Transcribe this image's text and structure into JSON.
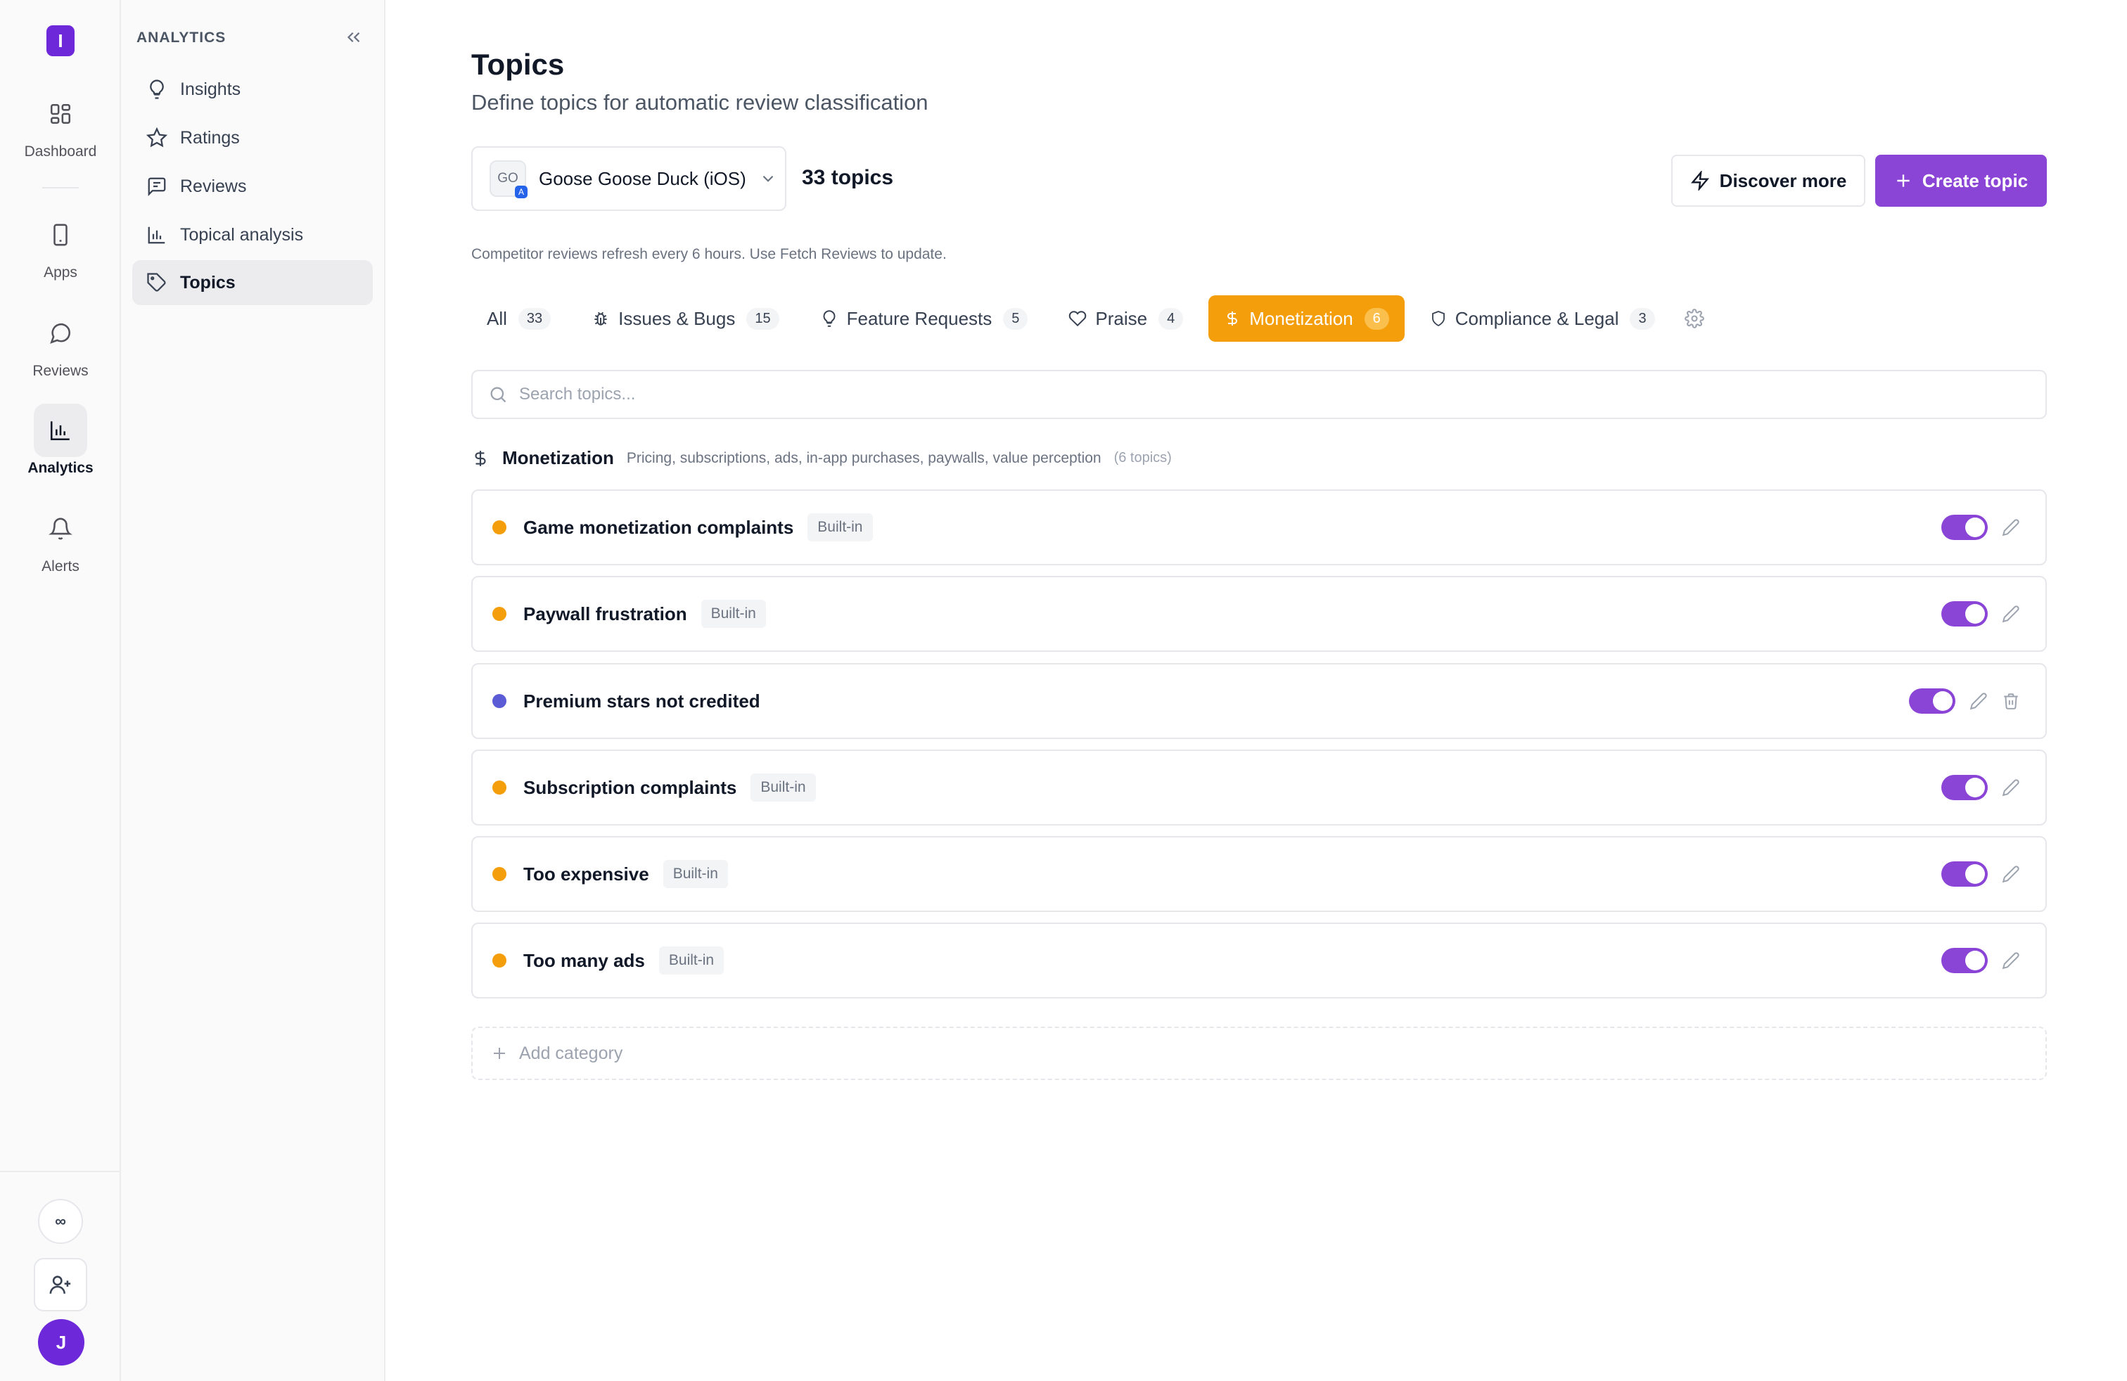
{
  "rail": {
    "logo_letter": "I",
    "items": [
      {
        "label": "Dashboard",
        "icon": "dashboard-grid-icon"
      },
      {
        "label": "Apps",
        "icon": "phone-icon"
      },
      {
        "label": "Reviews",
        "icon": "chat-bubble-icon"
      },
      {
        "label": "Analytics",
        "icon": "bar-chart-icon"
      },
      {
        "label": "Alerts",
        "icon": "bell-icon"
      }
    ],
    "infinity_symbol": "∞",
    "avatar_letter": "J"
  },
  "sidebar": {
    "section_title": "ANALYTICS",
    "items": [
      {
        "label": "Insights",
        "icon": "lightbulb-icon"
      },
      {
        "label": "Ratings",
        "icon": "star-icon"
      },
      {
        "label": "Reviews",
        "icon": "message-icon"
      },
      {
        "label": "Topical analysis",
        "icon": "bar-chart-icon"
      },
      {
        "label": "Topics",
        "icon": "tag-icon"
      }
    ]
  },
  "header": {
    "title": "Topics",
    "subtitle": "Define topics for automatic review classification"
  },
  "toolbar": {
    "app_thumb_text": "GO",
    "app_name": "Goose Goose Duck (iOS)",
    "topic_count": "33 topics",
    "discover_label": "Discover more",
    "create_label": "Create topic",
    "refresh_note": "Competitor reviews refresh every 6 hours. Use Fetch Reviews to update."
  },
  "tabs": [
    {
      "label": "All",
      "count": "33"
    },
    {
      "label": "Issues & Bugs",
      "count": "15"
    },
    {
      "label": "Feature Requests",
      "count": "5"
    },
    {
      "label": "Praise",
      "count": "4"
    },
    {
      "label": "Monetization",
      "count": "6"
    },
    {
      "label": "Compliance & Legal",
      "count": "3"
    }
  ],
  "search": {
    "placeholder": "Search topics..."
  },
  "category": {
    "name": "Monetization",
    "description": "Pricing, subscriptions, ads, in-app purchases, paywalls, value perception",
    "count_text": "(6 topics)"
  },
  "topics": [
    {
      "name": "Game monetization complaints",
      "badge": "Built-in",
      "color": "#f59e0b"
    },
    {
      "name": "Paywall frustration",
      "badge": "Built-in",
      "color": "#f59e0b"
    },
    {
      "name": "Premium stars not credited",
      "badge": "",
      "color": "#5b5bd6"
    },
    {
      "name": "Subscription complaints",
      "badge": "Built-in",
      "color": "#f59e0b"
    },
    {
      "name": "Too expensive",
      "badge": "Built-in",
      "color": "#f59e0b"
    },
    {
      "name": "Too many ads",
      "badge": "Built-in",
      "color": "#f59e0b"
    }
  ],
  "add_category_label": "Add category",
  "colors": {
    "accent": "#8b45d6",
    "active_tab": "#f59e0b",
    "brand": "#6d28d9"
  }
}
